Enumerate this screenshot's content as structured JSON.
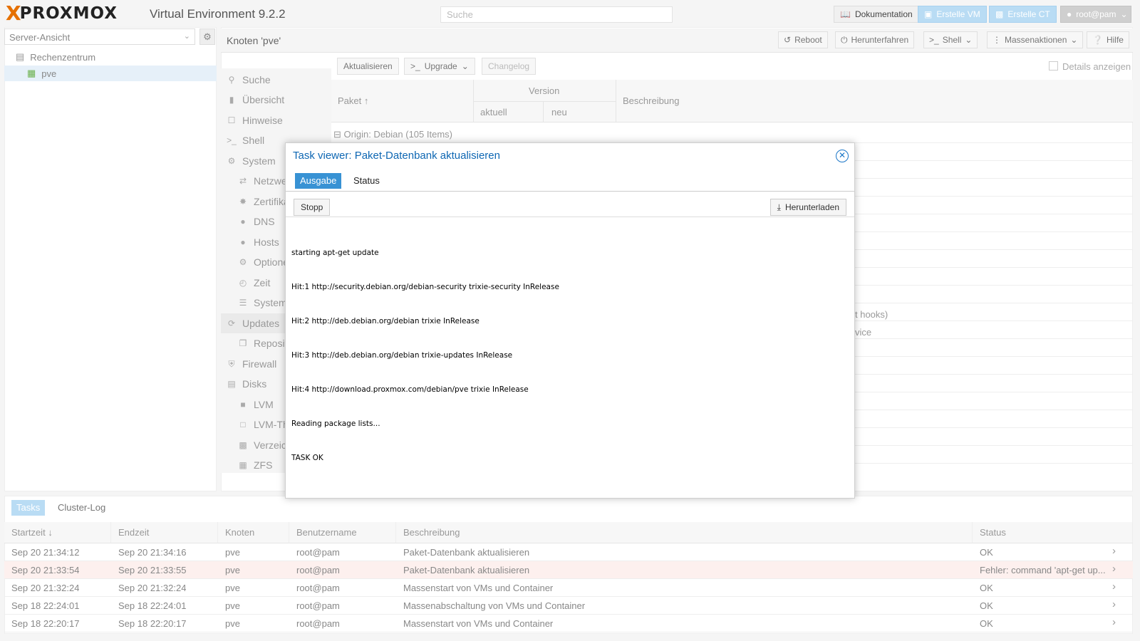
{
  "app": {
    "logo_x": "X",
    "logo_text": "PROXMOX",
    "version": "Virtual Environment 9.2.2",
    "search_placeholder": "Suche"
  },
  "topbar": {
    "docs": "Dokumentation",
    "create_vm": "Erstelle VM",
    "create_ct": "Erstelle CT",
    "user": "root@pam"
  },
  "tree": {
    "view": "Server-Ansicht",
    "datacenter": "Rechenzentrum",
    "node": "pve"
  },
  "node_header": {
    "title": "Knoten 'pve'",
    "reboot": "Reboot",
    "shutdown": "Herunterfahren",
    "shell": "Shell",
    "bulk": "Massenaktionen",
    "help": "Hilfe"
  },
  "nav": [
    {
      "label": "Suche",
      "icon": "search-icon"
    },
    {
      "label": "Übersicht",
      "icon": "book-icon"
    },
    {
      "label": "Hinweise",
      "icon": "note-icon"
    },
    {
      "label": "Shell",
      "icon": "terminal-icon"
    },
    {
      "label": "System",
      "icon": "gears-icon"
    },
    {
      "label": "Netzwerk",
      "icon": "exchange-icon"
    },
    {
      "label": "Zertifikate",
      "icon": "certificate-icon"
    },
    {
      "label": "DNS",
      "icon": "globe-icon"
    },
    {
      "label": "Hosts",
      "icon": "globe-icon"
    },
    {
      "label": "Optionen",
      "icon": "gear-icon"
    },
    {
      "label": "Zeit",
      "icon": "clock-icon"
    },
    {
      "label": "System-Log",
      "icon": "list-icon"
    },
    {
      "label": "Updates",
      "icon": "refresh-icon"
    },
    {
      "label": "Repositories",
      "icon": "files-icon"
    },
    {
      "label": "Firewall",
      "icon": "shield-icon"
    },
    {
      "label": "Disks",
      "icon": "hdd-icon"
    },
    {
      "label": "LVM",
      "icon": "square-icon"
    },
    {
      "label": "LVM-Thin",
      "icon": "square-outline-icon"
    },
    {
      "label": "Verzeichnis",
      "icon": "folder-icon"
    },
    {
      "label": "ZFS",
      "icon": "th-icon"
    }
  ],
  "updates": {
    "refresh": "Aktualisieren",
    "upgrade": "Upgrade",
    "changelog": "Changelog",
    "details": "Details anzeigen",
    "col_package": "Paket",
    "col_version": "Version",
    "col_current": "aktuell",
    "col_new": "neu",
    "col_description": "Beschreibung",
    "group_origin": "Origin: Debian (105 Items)",
    "partial_1": "t hooks)",
    "partial_2": "vice"
  },
  "task_viewer": {
    "title": "Task viewer: Paket-Datenbank aktualisieren",
    "tab_output": "Ausgabe",
    "tab_status": "Status",
    "stop": "Stopp",
    "download": "Herunterladen",
    "log": [
      "starting apt-get update",
      "Hit:1 http://security.debian.org/debian-security trixie-security InRelease",
      "Hit:2 http://deb.debian.org/debian trixie InRelease",
      "Hit:3 http://deb.debian.org/debian trixie-updates InRelease",
      "Hit:4 http://download.proxmox.com/debian/pve trixie InRelease",
      "Reading package lists...",
      "TASK OK"
    ]
  },
  "tasks": {
    "tab_tasks": "Tasks",
    "tab_cluster_log": "Cluster-Log",
    "columns": [
      "Startzeit",
      "Endzeit",
      "Knoten",
      "Benutzername",
      "Beschreibung",
      "Status"
    ],
    "rows": [
      {
        "start": "Sep 20 21:34:12",
        "end": "Sep 20 21:34:16",
        "node": "pve",
        "user": "root@pam",
        "desc": "Paket-Datenbank aktualisieren",
        "status": "OK",
        "error": false
      },
      {
        "start": "Sep 20 21:33:54",
        "end": "Sep 20 21:33:55",
        "node": "pve",
        "user": "root@pam",
        "desc": "Paket-Datenbank aktualisieren",
        "status": "Fehler: command 'apt-get up...",
        "error": true
      },
      {
        "start": "Sep 20 21:32:24",
        "end": "Sep 20 21:32:24",
        "node": "pve",
        "user": "root@pam",
        "desc": "Massenstart von VMs und Container",
        "status": "OK",
        "error": false
      },
      {
        "start": "Sep 18 22:24:01",
        "end": "Sep 18 22:24:01",
        "node": "pve",
        "user": "root@pam",
        "desc": "Massenabschaltung von VMs und Container",
        "status": "OK",
        "error": false
      },
      {
        "start": "Sep 18 22:20:17",
        "end": "Sep 18 22:20:17",
        "node": "pve",
        "user": "root@pam",
        "desc": "Massenstart von VMs und Container",
        "status": "OK",
        "error": false
      }
    ]
  },
  "colors": {
    "accent": "#3892d4",
    "title_blue": "#0e67b3",
    "logo_orange": "#e57000",
    "error_row": "#fdf0ee"
  }
}
